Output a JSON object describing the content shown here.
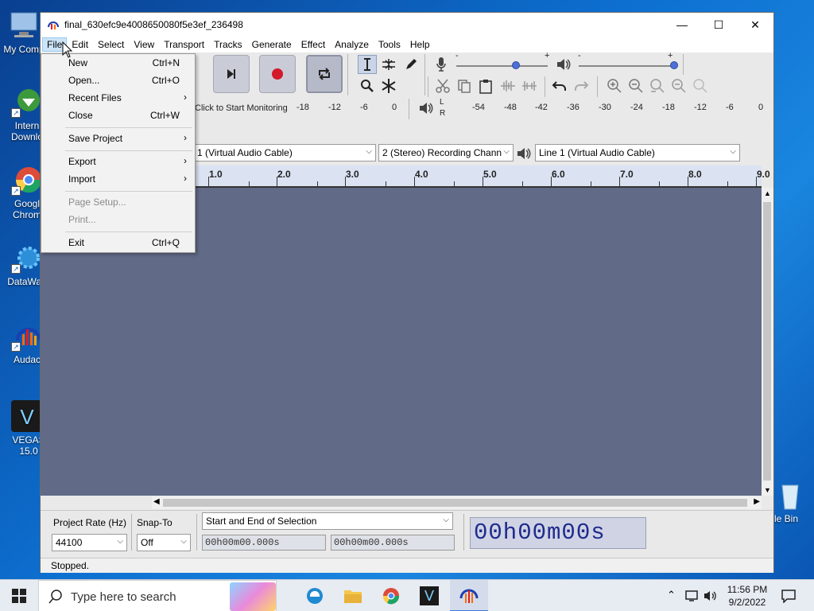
{
  "desktop": {
    "icons": [
      {
        "label": "My Comp",
        "icon": "computer-icon"
      },
      {
        "label": "Intern Downlo",
        "icon": "download-manager-icon"
      },
      {
        "label": "Googl Chrom",
        "icon": "chrome-icon"
      },
      {
        "label": "DataWag",
        "icon": "datawag-icon"
      },
      {
        "label": "Audac",
        "icon": "audacity-icon"
      },
      {
        "label": "VEGAS 15.0",
        "icon": "vegas-icon"
      },
      {
        "label": "cle Bin",
        "icon": "recycle-bin-icon"
      }
    ]
  },
  "window": {
    "title": "final_630efc9e4008650080f5e3ef_236498",
    "controls": {
      "minimize": "—",
      "maximize": "☐",
      "close": "✕"
    }
  },
  "menubar": {
    "items": [
      "File",
      "Edit",
      "Select",
      "View",
      "Transport",
      "Tracks",
      "Generate",
      "Effect",
      "Analyze",
      "Tools",
      "Help"
    ]
  },
  "file_menu": {
    "items": [
      {
        "label": "New",
        "shortcut": "Ctrl+N"
      },
      {
        "label": "Open...",
        "shortcut": "Ctrl+O"
      },
      {
        "label": "Recent Files",
        "submenu": "›"
      },
      {
        "label": "Close",
        "shortcut": "Ctrl+W"
      },
      {
        "label": "Save Project",
        "submenu": "›"
      },
      {
        "label": "Export",
        "submenu": "›"
      },
      {
        "label": "Import",
        "submenu": "›"
      },
      {
        "label": "Page Setup...",
        "disabled": true
      },
      {
        "label": "Print...",
        "disabled": true
      },
      {
        "label": "Exit",
        "shortcut": "Ctrl+Q"
      }
    ]
  },
  "meters": {
    "monitor_text": "Click to Start Monitoring",
    "record_scale": [
      "-18",
      "-12",
      "-6",
      "0"
    ],
    "playback_scale": [
      "-54",
      "-48",
      "-42",
      "-36",
      "-30",
      "-24",
      "-18",
      "-12",
      "-6",
      "0"
    ],
    "lr": [
      "L",
      "R"
    ],
    "slider_minus": "-",
    "slider_plus": "+"
  },
  "devices": {
    "recording_device": "1 (Virtual Audio Cable)",
    "channels": "2 (Stereo) Recording Chann",
    "playback_device": "Line 1 (Virtual Audio Cable)"
  },
  "ruler": {
    "labels": [
      "1.0",
      "2.0",
      "3.0",
      "4.0",
      "5.0",
      "6.0",
      "7.0",
      "8.0",
      "9.0"
    ]
  },
  "selection_toolbar": {
    "project_rate_label": "Project Rate (Hz)",
    "project_rate_value": "44100",
    "snap_to_label": "Snap-To",
    "snap_to_value": "Off",
    "selection_mode": "Start and End of Selection",
    "start_time": "00h00m00.000s",
    "end_time": "00h00m00.000s",
    "audio_position": "00h00m00s"
  },
  "status": {
    "text": "Stopped."
  },
  "taskbar": {
    "search_placeholder": "Type here to search",
    "time": "11:56 PM",
    "date": "9/2/2022"
  },
  "colors": {
    "track_bg": "#616a87",
    "ruler_bg": "#dbe3f3",
    "record_red": "#d4192b",
    "accent_blue": "#4d6fd6"
  }
}
